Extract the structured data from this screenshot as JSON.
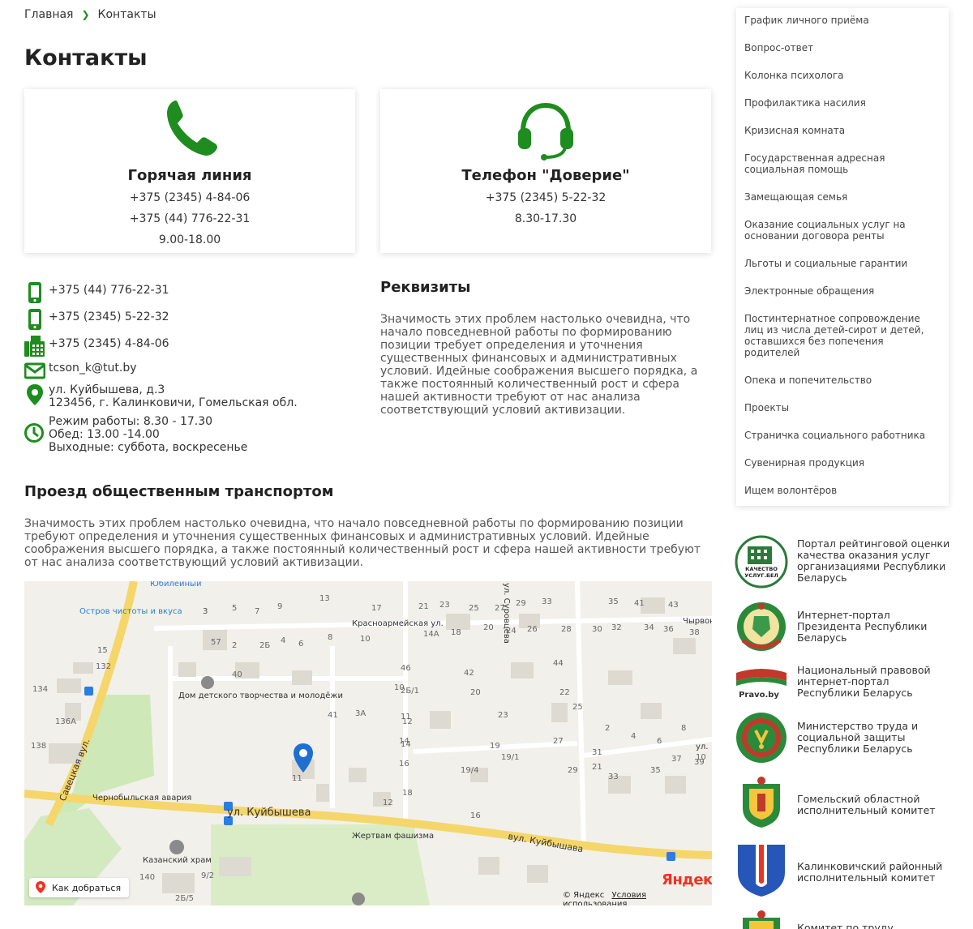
{
  "breadcrumb": {
    "home": "Главная",
    "current": "Контакты"
  },
  "page_title": "Контакты",
  "cards": [
    {
      "title": "Горячая линия",
      "lines": [
        "+375 (2345) 4-84-06",
        "+375 (44) 776-22-31",
        "9.00-18.00"
      ],
      "icon": "phone-icon"
    },
    {
      "title": "Телефон \"Доверие\"",
      "lines": [
        "+375 (2345) 5-22-32",
        "8.30-17.30"
      ],
      "icon": "headset-icon"
    }
  ],
  "contacts": {
    "mobile1": "+375 (44) 776-22-31",
    "mobile2": "+375 (2345) 5-22-32",
    "fax": "+375 (2345) 4-84-06",
    "email": "tcson_k@tut.by",
    "address_line1": "ул. Куйбышева, д.3",
    "address_line2": "123456, г. Калинковичи, Гомельская обл.",
    "hours_line1": "Режим работы: 8.30 - 17.30",
    "hours_line2": "Обед: 13.00 -14.00",
    "hours_line3": "Выходные: суббота, воскресенье"
  },
  "requisites": {
    "title": "Реквизиты",
    "text": "Значимость этих проблем настолько очевидна, что начало повседневной работы по формированию позиции требует определения и уточнения существенных финансовых и административных условий. Идейные соображения высшего порядка, а также постоянный количественный рост и сфера нашей активности требуют от нас анализа соответствующий условий активизации."
  },
  "transport": {
    "title": "Проезд общественным транспортом",
    "text": "Значимость этих проблем настолько очевидна, что начало повседневной работы по формированию позиции требуют определения и уточнения существенных финансовых и административных условий. Идейные соображения высшего порядка, а также постоянный количественный рост и сфера нашей активности требуют от нас анализа соответствующий условий активизации."
  },
  "map": {
    "route_button": "Как добраться",
    "brand": "Яндекс",
    "copyright": "© Яндекс",
    "terms": "Условия использования",
    "labels": {
      "street_kuibysheva": "ул. Куйбышева",
      "street_kuibysheva_by": "вул. Куйбышава",
      "street_savetskaya": "Савецкая вул.",
      "street_krasnoarmeyskaya": "Красноармейская ул.",
      "street_surovtseva": "ул. Суровцева",
      "chyrvon": "Чырвон",
      "poi_island": "Остров чистоты и вкуса",
      "poi_yubileiny": "Юбилейный",
      "poi_house": "Дом детского творчества и молодёжи",
      "poi_chernobyl": "Чернобыльская авария",
      "poi_victims": "Жертвам фашизма",
      "poi_church": "Казанский храм",
      "vul": "ул."
    },
    "house_numbers": [
      "3",
      "5",
      "7",
      "9",
      "13",
      "17",
      "21",
      "23",
      "25",
      "27",
      "29",
      "33",
      "35",
      "41",
      "43",
      "57",
      "2",
      "2Б",
      "4",
      "6",
      "8",
      "10",
      "14А",
      "18",
      "20",
      "24",
      "26",
      "28",
      "30",
      "32",
      "34",
      "36",
      "38",
      "40",
      "42",
      "44",
      "46",
      "2Б/1",
      "10",
      "12",
      "14",
      "16",
      "18",
      "20",
      "22",
      "23",
      "25",
      "27",
      "29",
      "31",
      "33",
      "35",
      "37",
      "39",
      "41",
      "3А",
      "11",
      "14",
      "16",
      "19",
      "19/1",
      "19/4",
      "21",
      "2",
      "4",
      "6",
      "8",
      "10",
      "12",
      "15",
      "132",
      "134",
      "136А",
      "138",
      "140",
      "9/2",
      "2Б/5",
      "11",
      "3"
    ]
  },
  "sidebar": {
    "items": [
      "График личного приёма",
      "Вопрос-ответ",
      "Колонка психолога",
      "Профилактика насилия",
      "Кризисная комната",
      "Государственная адресная социальная помощь",
      "Замещающая семья",
      "Оказание социальных услуг на основании договора ренты",
      "Льготы и социальные гарантии",
      "Электронные обращения",
      "Постинтернатное сопровождение лиц из числа детей-сирот и детей, оставшихся без попечения родителей",
      "Опека и попечительство",
      "Проекты",
      "Страничка социального работника",
      "Сувенирная продукция",
      "Ищем волонтёров"
    ]
  },
  "links": [
    {
      "text": "Портал рейтинговой оценки качества оказания услуг организациями Республики Беларусь",
      "logo": "quality-logo",
      "logo_text": "КАЧЕСТВО УСЛУГ.БЕЛ"
    },
    {
      "text": "Интернет-портал Президента Республики Беларусь",
      "logo": "belarus-emblem-logo"
    },
    {
      "text": "Национальный правовой интернет-портал Республики Беларусь",
      "logo": "pravo-logo",
      "logo_text": "Pravo.by"
    },
    {
      "text": "Министерство труда и социальной защиты Республики Беларусь",
      "logo": "ministry-emblem-logo"
    },
    {
      "text": "Гомельский областной исполнительный комитет",
      "logo": "gomel-emblem-logo"
    },
    {
      "text": "Калинковичский районный исполнительный комитет",
      "logo": "kalinkovichi-emblem-logo"
    },
    {
      "text": "Комитет по труду, занятости",
      "logo": "committee-emblem-logo"
    }
  ],
  "colors": {
    "accent": "#1e8c1e",
    "text": "#222222",
    "muted": "#555555",
    "map_road": "#f5d66a"
  }
}
